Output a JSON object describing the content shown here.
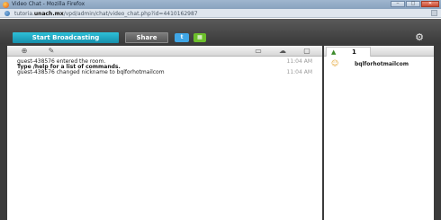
{
  "window": {
    "title": "Video Chat - Mozilla Firefox",
    "url_prefix": "tutoria.",
    "url_domain": "unach.mx",
    "url_rest": "/vpd/admin/chat/video_chat.php?id=4410162987",
    "min": "‒",
    "max": "□",
    "close": "✕"
  },
  "toolbar": {
    "broadcast_label": "Start Broadcasting",
    "share_label": "Share",
    "twitter_icon_glyph": "t",
    "green_icon_glyph": "▦",
    "settings_icon_glyph": "⚙"
  },
  "chat_tools": {
    "zoom": "⊕",
    "pen": "✎",
    "tube": "▭",
    "cloud": "☁",
    "box": "▢"
  },
  "messages": [
    {
      "text": "guest-438576 entered the room.",
      "time": "11:04 AM",
      "bold": false
    },
    {
      "text": "Type /help for a list of commands.",
      "time": "",
      "bold": true
    },
    {
      "text": "guest-438576 changed nickname to bqlforhotmailcom",
      "time": "11:04 AM",
      "bold": false
    }
  ],
  "users": {
    "count": "1",
    "tab_icon": "▲",
    "list": [
      {
        "name": "bqlforhotmailcom",
        "icon": "☺"
      }
    ]
  },
  "colors": {
    "accent": "#1fa9c4",
    "app_background": "#3b3b3b"
  }
}
